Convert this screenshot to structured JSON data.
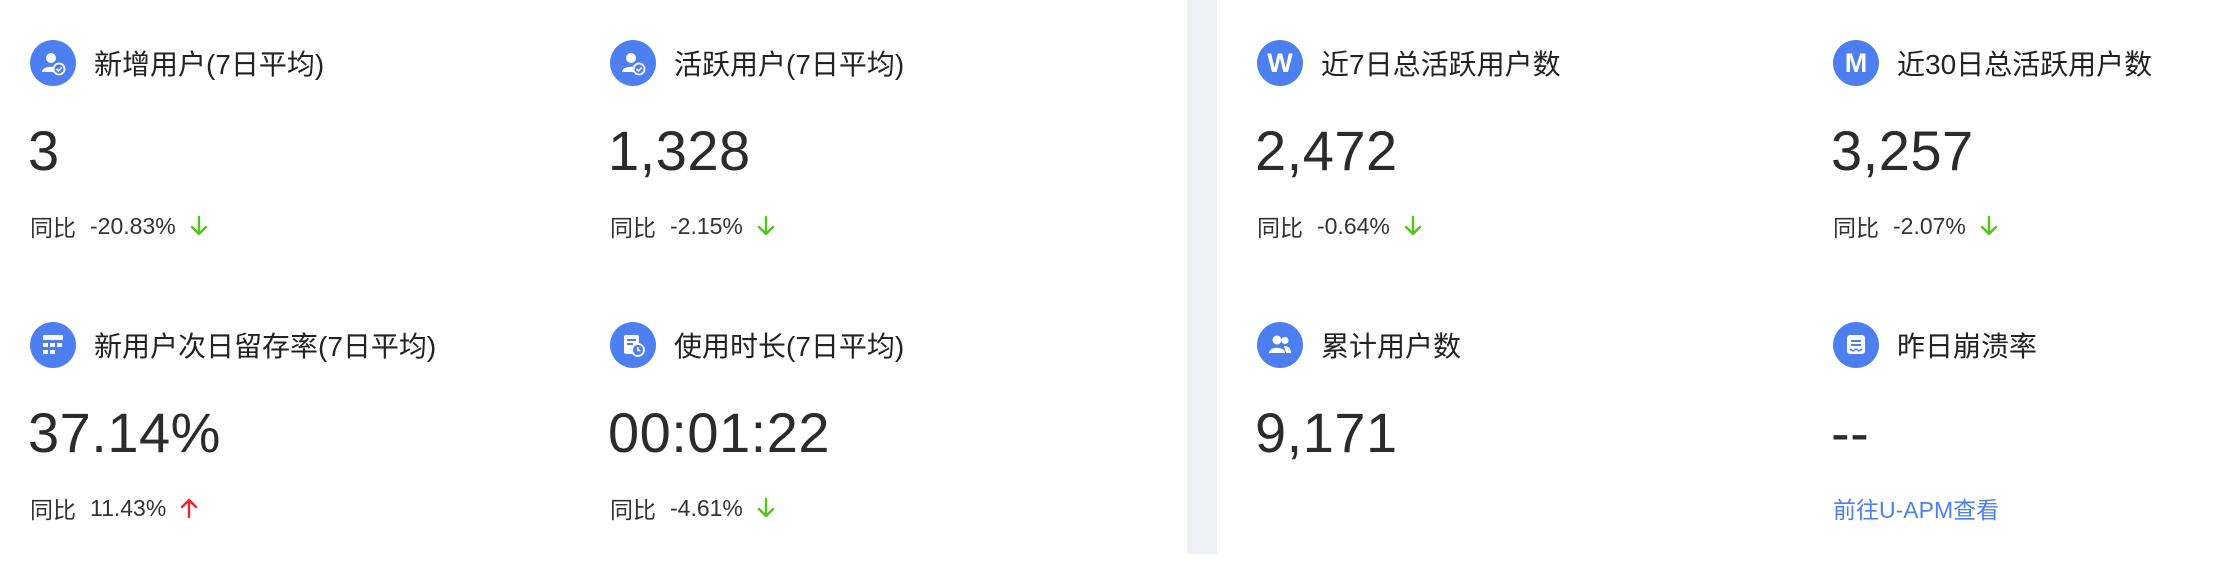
{
  "colors": {
    "accent": "#4e7ff0",
    "down": "#52c41a",
    "up": "#f5222d",
    "divider": "#eef0f5"
  },
  "left_cards": [
    {
      "icon": "user-badge-icon",
      "title": "新增用户(7日平均)",
      "value": "3",
      "compare_label": "同比",
      "compare_value": "-20.83%",
      "trend": "down"
    },
    {
      "icon": "user-badge-icon",
      "title": "活跃用户(7日平均)",
      "value": "1,328",
      "compare_label": "同比",
      "compare_value": "-2.15%",
      "trend": "down"
    },
    {
      "icon": "grid-icon",
      "title": "新用户次日留存率(7日平均)",
      "value": "37.14%",
      "compare_label": "同比",
      "compare_value": "11.43%",
      "trend": "up"
    },
    {
      "icon": "clock-document-icon",
      "title": "使用时长(7日平均)",
      "value": "00:01:22",
      "compare_label": "同比",
      "compare_value": "-4.61%",
      "trend": "down"
    }
  ],
  "right_cards": [
    {
      "icon": "letter-w-icon",
      "icon_text": "W",
      "title": "近7日总活跃用户数",
      "value": "2,472",
      "compare_label": "同比",
      "compare_value": "-0.64%",
      "trend": "down"
    },
    {
      "icon": "letter-m-icon",
      "icon_text": "M",
      "title": "近30日总活跃用户数",
      "value": "3,257",
      "compare_label": "同比",
      "compare_value": "-2.07%",
      "trend": "down"
    },
    {
      "icon": "users-group-icon",
      "title": "累计用户数",
      "value": "9,171"
    },
    {
      "icon": "crash-report-icon",
      "title": "昨日崩溃率",
      "value": "--",
      "link_text": "前往U-APM查看"
    }
  ]
}
